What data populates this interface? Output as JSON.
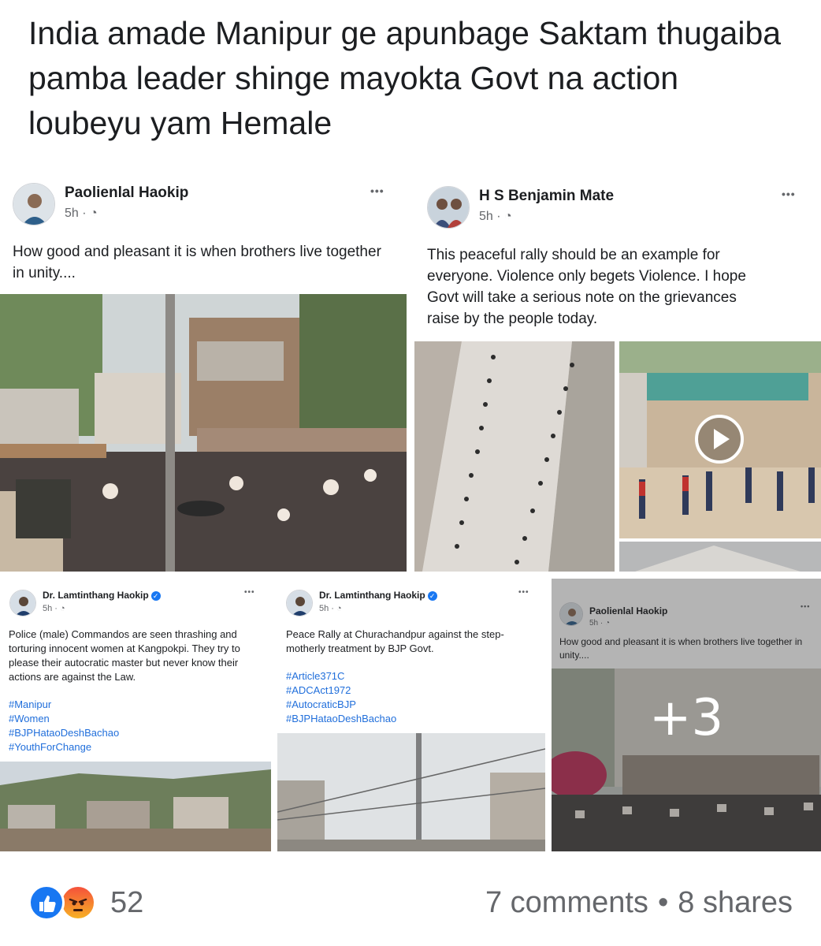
{
  "post": {
    "text": "India amade Manipur ge apunbage Saktam thugaiba pamba leader shinge mayokta Govt na action loubeyu yam Hemale"
  },
  "shared": [
    {
      "author": "Paolienlal Haokip",
      "time": "5h ·",
      "menu": "•••",
      "text": "How good and pleasant it is when brothers live together in unity...."
    },
    {
      "author": "H S Benjamin Mate",
      "time": "5h ·",
      "menu": "•••",
      "text": "This peaceful rally should be an example for everyone. Violence only begets Violence. I hope Govt will take a serious note on the grievances raise by the people today."
    },
    {
      "author": "Dr. Lamtinthang Haokip",
      "time": "5h ·",
      "menu": "•••",
      "text": "Police (male) Commandos are seen thrashing and torturing innocent women at Kangpokpi. They try to please their autocratic master but never know their actions are against the Law.",
      "tags": [
        "#Manipur",
        "#Women",
        "#BJPHataoDeshBachao",
        "#YouthForChange"
      ]
    },
    {
      "author": "Dr. Lamtinthang Haokip",
      "time": "5h ·",
      "menu": "•••",
      "text": "Peace Rally at Churachandpur against the step-motherly treatment by BJP Govt.",
      "tags": [
        "#Article371C",
        "#ADCAct1972",
        "#AutocraticBJP",
        "#BJPHataoDeshBachao"
      ]
    },
    {
      "author": "Paolienlal Haokip",
      "time": "5h ·",
      "menu": "•••",
      "text": "How good and pleasant it is when brothers live together in unity...."
    }
  ],
  "more_count": "+3",
  "footer": {
    "reaction_count": "52",
    "comments": "7 comments",
    "separator": "•",
    "shares": "8 shares"
  },
  "colors": {
    "link_blue": "#216fdb",
    "like_blue": "#1877f2",
    "muted": "#65676b"
  }
}
